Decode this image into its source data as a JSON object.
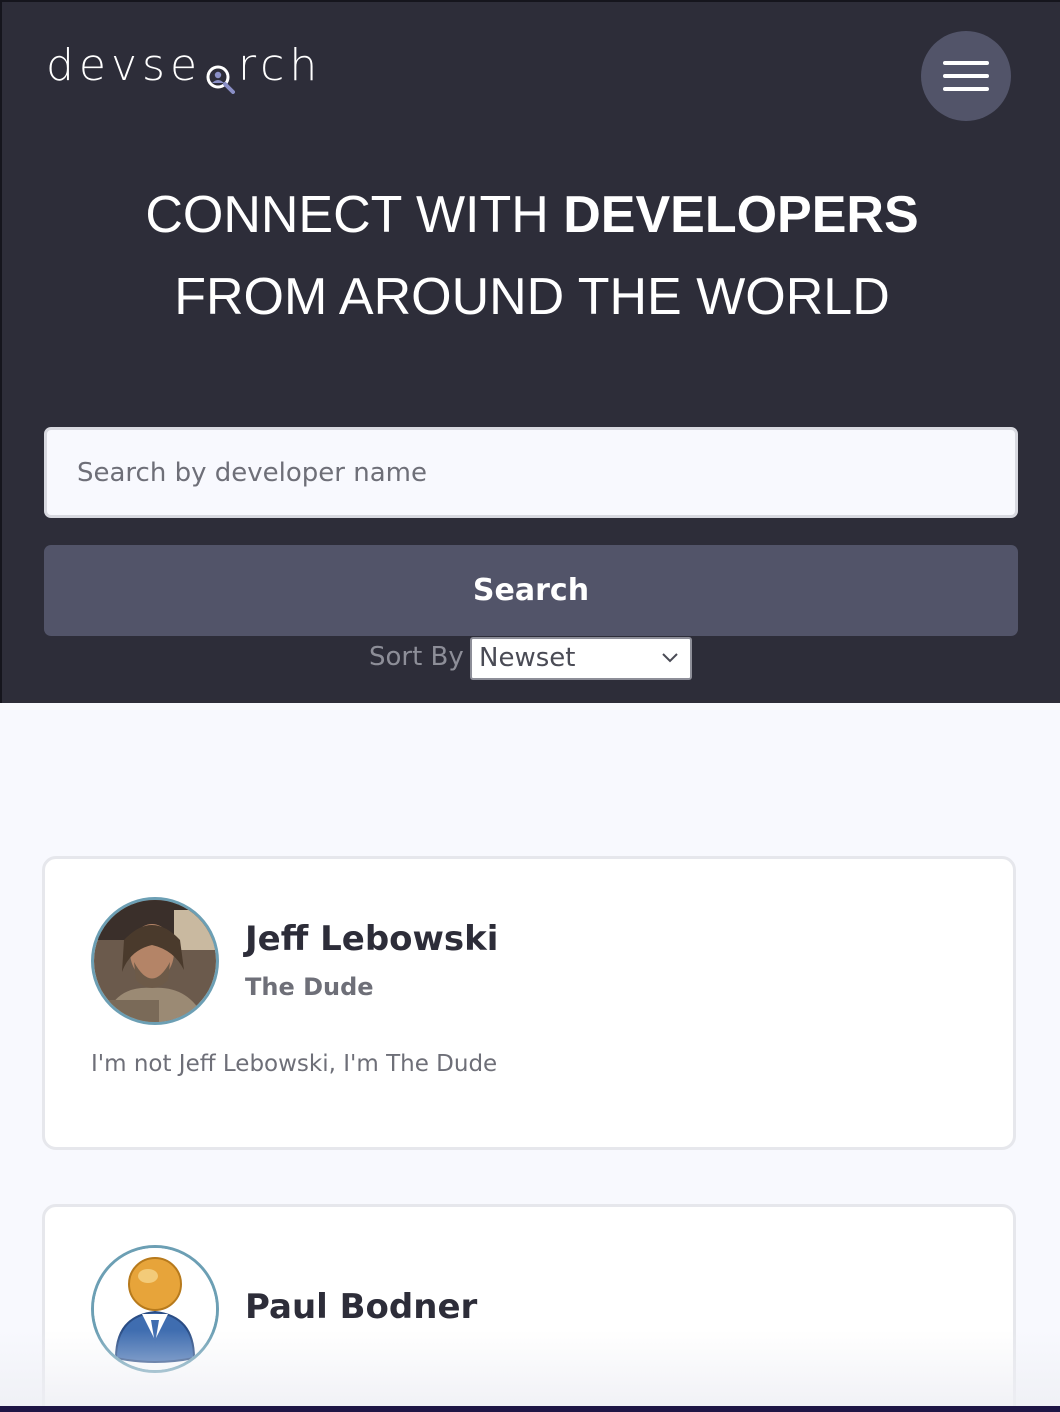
{
  "header": {
    "logo_left": "devse",
    "logo_right": "rch",
    "menu_icon": "hamburger-menu-icon"
  },
  "hero": {
    "line1_light": "CONNECT WITH ",
    "line1_bold": "DEVELOPERS",
    "line2": "FROM AROUND THE WORLD"
  },
  "search": {
    "placeholder": "Search by developer name",
    "value": "",
    "button_label": "Search"
  },
  "sort": {
    "label": "Sort By",
    "selected": "Newset"
  },
  "developers": [
    {
      "name": "Jeff Lebowski",
      "title": "The Dude",
      "bio": "I'm not Jeff Lebowski, I'm The Dude",
      "avatar_icon": "profile-photo"
    },
    {
      "name": "Paul Bodner",
      "title": "",
      "bio": "",
      "avatar_icon": "default-user-icon"
    }
  ],
  "colors": {
    "hero_bg": "#2d2d39",
    "accent": "#525469",
    "avatar_ring": "#6c9fb4",
    "page_bg": "#f8f9fe"
  }
}
